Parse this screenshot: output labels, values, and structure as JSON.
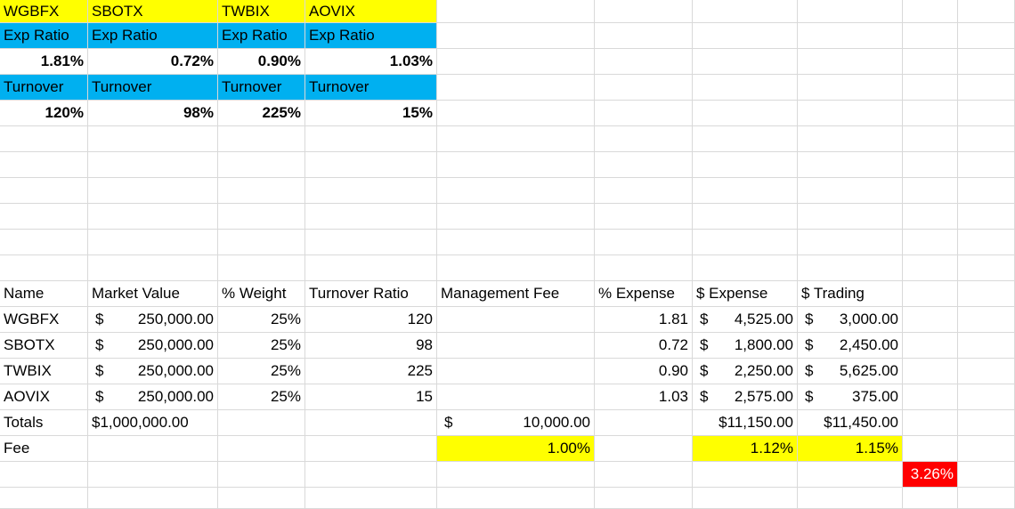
{
  "colors": {
    "yellow": "#ffff00",
    "blue": "#00b0f0",
    "red": "#ff0000",
    "grid": "#d9d9d9"
  },
  "top": {
    "tickers": [
      "WGBFX",
      "SBOTX",
      "TWBIX",
      "AOVIX"
    ],
    "exp_label": "Exp Ratio",
    "exp_values": [
      "1.81%",
      "0.72%",
      "0.90%",
      "1.03%"
    ],
    "turnover_label": "Turnover",
    "turnover_values": [
      "120%",
      "98%",
      "225%",
      "15%"
    ]
  },
  "table": {
    "headers": [
      "Name",
      "Market Value",
      "% Weight",
      "Turnover Ratio",
      "Management Fee",
      "% Expense",
      "$ Expense",
      "$ Trading"
    ],
    "rows": [
      {
        "name": "WGBFX",
        "mv_sym": "$",
        "mv": "250,000.00",
        "weight": "25%",
        "turnover": "120",
        "pct_exp": "1.81",
        "exp_sym": "$",
        "exp": "4,525.00",
        "trd_sym": "$",
        "trd": "3,000.00"
      },
      {
        "name": "SBOTX",
        "mv_sym": "$",
        "mv": "250,000.00",
        "weight": "25%",
        "turnover": "98",
        "pct_exp": "0.72",
        "exp_sym": "$",
        "exp": "1,800.00",
        "trd_sym": "$",
        "trd": "2,450.00"
      },
      {
        "name": "TWBIX",
        "mv_sym": "$",
        "mv": "250,000.00",
        "weight": "25%",
        "turnover": "225",
        "pct_exp": "0.90",
        "exp_sym": "$",
        "exp": "2,250.00",
        "trd_sym": "$",
        "trd": "5,625.00"
      },
      {
        "name": "AOVIX",
        "mv_sym": "$",
        "mv": "250,000.00",
        "weight": "25%",
        "turnover": "15",
        "pct_exp": "1.03",
        "exp_sym": "$",
        "exp": "2,575.00",
        "trd_sym": "$",
        "trd": "375.00"
      }
    ],
    "totals": {
      "label": "Totals",
      "mv": "$1,000,000.00",
      "mgmt_sym": "$",
      "mgmt": "10,000.00",
      "exp": "$11,150.00",
      "trd": "$11,450.00"
    },
    "fee": {
      "label": "Fee",
      "mgmt": "1.00%",
      "exp": "1.12%",
      "trd": "1.15%"
    },
    "total_fee": "3.26%"
  }
}
